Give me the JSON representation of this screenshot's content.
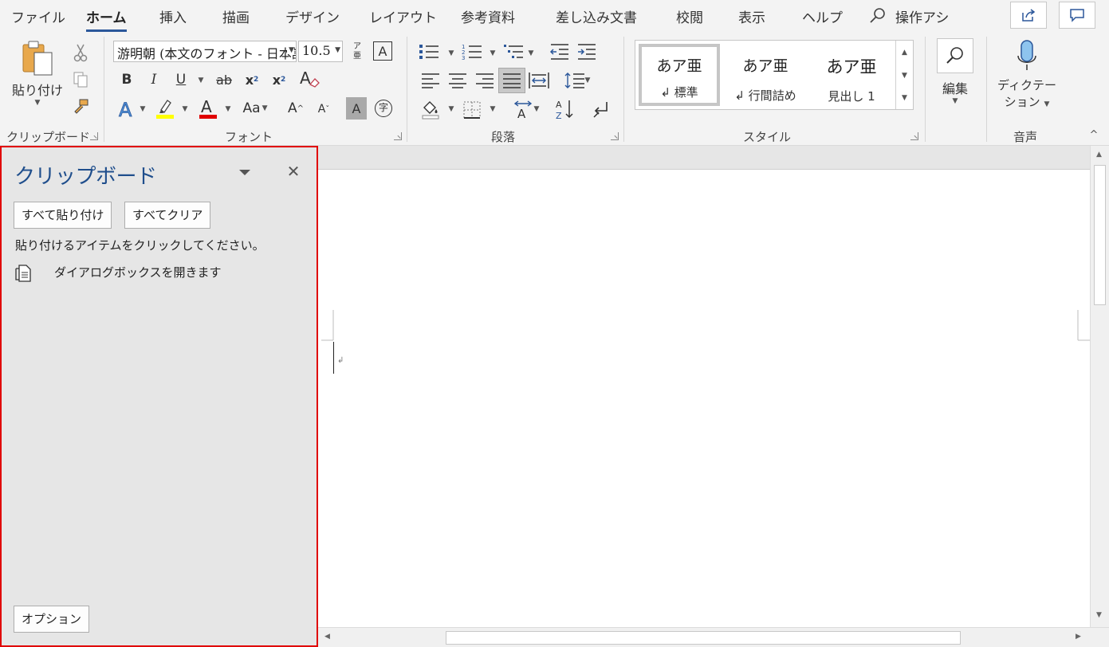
{
  "tabs": [
    {
      "label": "ファイル",
      "active": false
    },
    {
      "label": "ホーム",
      "active": true
    },
    {
      "label": "挿入",
      "active": false
    },
    {
      "label": "描画",
      "active": false
    },
    {
      "label": "デザイン",
      "active": false
    },
    {
      "label": "レイアウト",
      "active": false
    },
    {
      "label": "参考資料",
      "active": false
    },
    {
      "label": "差し込み文書",
      "active": false
    },
    {
      "label": "校閲",
      "active": false
    },
    {
      "label": "表示",
      "active": false
    },
    {
      "label": "ヘルプ",
      "active": false
    }
  ],
  "tell_me": "操作アシ",
  "ribbon": {
    "clipboard": {
      "label": "クリップボード",
      "paste_label": "貼り付け"
    },
    "font": {
      "label": "フォント",
      "font_name": "游明朝 (本文のフォント - 日本語)",
      "font_size": "10.5",
      "phonetic_top": "ア",
      "phonetic_bottom": "亜",
      "bold": "B",
      "italic": "I",
      "underline": "U",
      "strike": "ab",
      "subscript": "x",
      "superscript": "x",
      "case_label": "Aa",
      "grow": "A",
      "shrink": "A",
      "shade_char": "A",
      "enclose_char": "字",
      "clear_format": "A",
      "text_effect": "A",
      "font_color_letter": "A"
    },
    "paragraph": {
      "label": "段落"
    },
    "styles": {
      "label": "スタイル",
      "items": [
        {
          "sample": "あア亜",
          "name": "↲ 標準"
        },
        {
          "sample": "あア亜",
          "name": "↲ 行間詰め"
        },
        {
          "sample": "あア亜",
          "name": "見出し 1"
        }
      ]
    },
    "editing": {
      "label": "編集"
    },
    "voice": {
      "label": "音声",
      "dictate_line1": "ディクテー",
      "dictate_line2": "ション"
    }
  },
  "clipboard_pane": {
    "title": "クリップボード",
    "paste_all": "すべて貼り付け",
    "clear_all": "すべてクリア",
    "hint": "貼り付けるアイテムをクリックしてください。",
    "items": [
      {
        "text": "ダイアログボックスを開きます"
      }
    ],
    "options": "オプション"
  },
  "document": {
    "paragraph_mark": "↲"
  },
  "colors": {
    "accent": "#2b579a",
    "pane_border": "#e00000",
    "pane_title": "#1f4e8c",
    "highlight": "#ffff00",
    "font_color": "#e00000"
  }
}
